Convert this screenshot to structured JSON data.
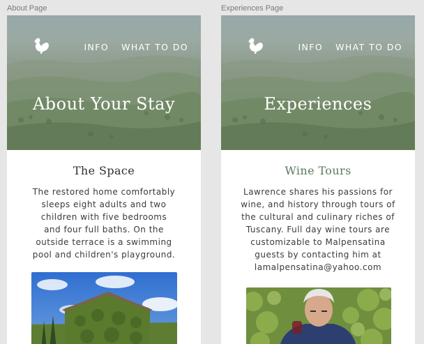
{
  "frames": {
    "about": {
      "label": "About Page",
      "nav": {
        "info": "INFO",
        "what_to_do": "WHAT TO DO"
      },
      "hero_title": "About Your Stay",
      "section_title": "The Space",
      "body_lines": [
        "The restored home comfortably",
        "sleeps eight adults and two",
        "children with five bedrooms",
        "and four full baths. On the",
        "outside terrace is a swimming",
        "pool and children's playground."
      ]
    },
    "experiences": {
      "label": "Experiences Page",
      "nav": {
        "info": "INFO",
        "what_to_do": "WHAT TO DO"
      },
      "hero_title": "Experiences",
      "section_title": "Wine Tours",
      "body_lines": [
        "Lawrence shares his passions for",
        "wine, and history through tours of",
        "the cultural and culinary riches of",
        "Tuscany. Full day wine tours are",
        "customizable to Malpensatina",
        "guests by contacting him at",
        "lamalpensatina@yahoo.com"
      ]
    }
  },
  "colors": {
    "canvas": "#e6e6e6",
    "heading_dark": "#2f2f2f",
    "heading_green": "#5b7a5e",
    "body_text": "#3a3a3a",
    "nav_text": "#ffffff"
  },
  "icons": {
    "logo": "rooster-icon"
  }
}
